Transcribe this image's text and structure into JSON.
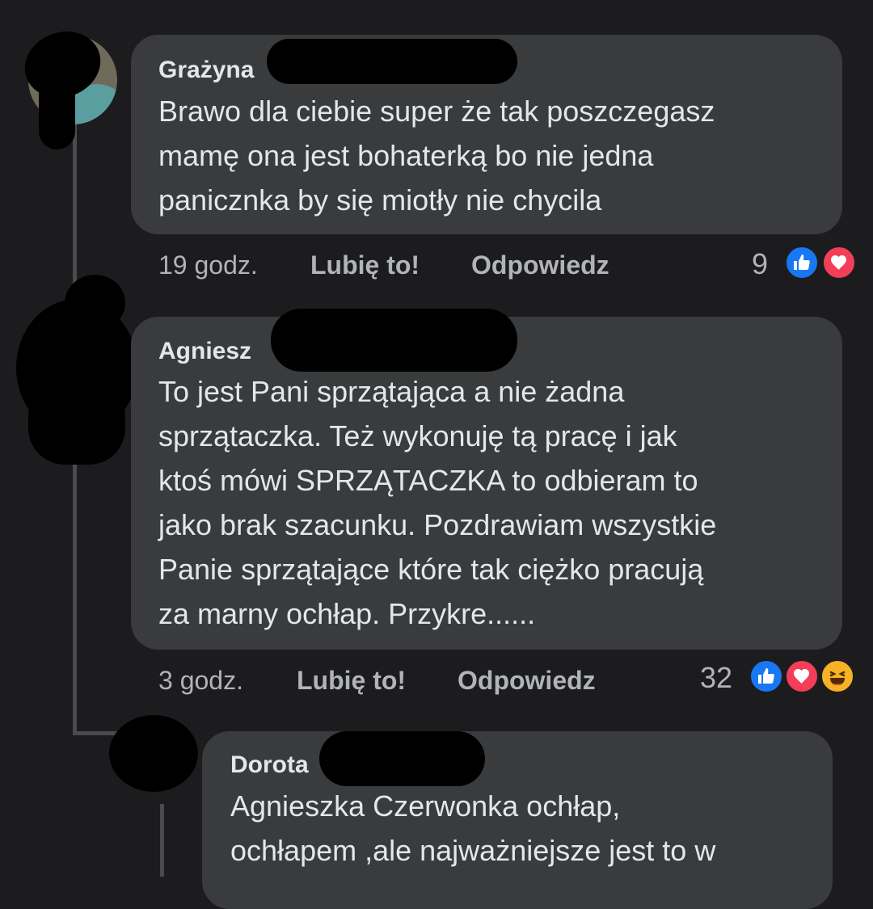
{
  "comments": [
    {
      "author": "Grażyna",
      "lines": [
        "Brawo dla ciebie super że tak poszczegasz",
        "mamę ona jest bohaterką bo nie jedna",
        "panicznka by się miotły nie chycila"
      ],
      "time": "19 godz.",
      "like_label": "Lubię to!",
      "reply_label": "Odpowiedz",
      "reaction_count": "9",
      "reactions": [
        "like-icon",
        "love-icon"
      ]
    },
    {
      "author": "Agniesz",
      "lines": [
        "To jest Pani sprzątająca  a nie żadna",
        "sprzątaczka. Też wykonuję tą pracę i jak",
        "ktoś mówi SPRZĄTACZKA to odbieram to",
        "jako brak szacunku. Pozdrawiam wszystkie",
        "Panie sprzątające które tak ciężko pracują",
        "za marny ochłap. Przykre......"
      ],
      "time": "3 godz.",
      "like_label": "Lubię to!",
      "reply_label": "Odpowiedz",
      "reaction_count": "32",
      "reactions": [
        "like-icon",
        "love-icon",
        "haha-icon"
      ]
    }
  ],
  "reply": {
    "author": "Dorota",
    "lines": [
      "Agnieszka Czerwonka ochłap,",
      "ochłapem ,ale najważniejsze jest to w"
    ]
  },
  "colors": {
    "background": "#1c1c1e",
    "bubble": "#3a3b3d",
    "like": "#1877f2",
    "love": "#f33e58",
    "haha": "#f7b125"
  }
}
